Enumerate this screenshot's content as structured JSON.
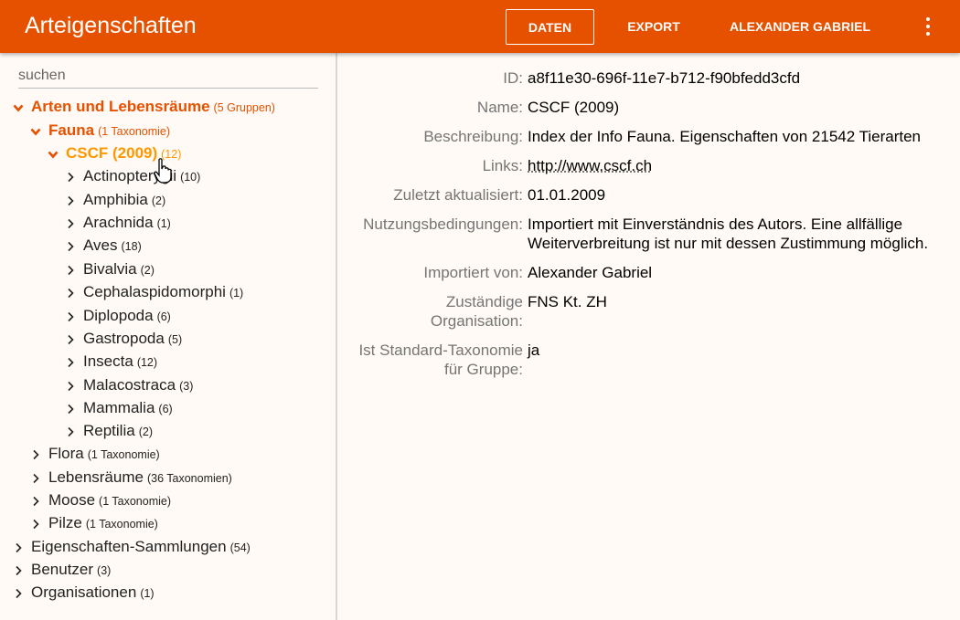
{
  "header": {
    "title": "Arteigenschaften",
    "nav": [
      "Daten",
      "Export",
      "Alexander Gabriel"
    ],
    "more_icon": "more-vert-icon"
  },
  "search": {
    "placeholder": "suchen",
    "value": ""
  },
  "tree": [
    {
      "label": "Arten und Lebensräume",
      "count": "(5 Gruppen)",
      "state": "open"
    },
    {
      "label": "Fauna",
      "count": "(1 Taxonomie)",
      "state": "open"
    },
    {
      "label": "CSCF (2009)",
      "count": "(12)",
      "state": "selected"
    },
    {
      "label": "Actinopterygii",
      "count": "(10)",
      "state": "closed"
    },
    {
      "label": "Amphibia",
      "count": "(2)",
      "state": "closed"
    },
    {
      "label": "Arachnida",
      "count": "(1)",
      "state": "closed"
    },
    {
      "label": "Aves",
      "count": "(18)",
      "state": "closed"
    },
    {
      "label": "Bivalvia",
      "count": "(2)",
      "state": "closed"
    },
    {
      "label": "Cephalaspidomorphi",
      "count": "(1)",
      "state": "closed"
    },
    {
      "label": "Diplopoda",
      "count": "(6)",
      "state": "closed"
    },
    {
      "label": "Gastropoda",
      "count": "(5)",
      "state": "closed"
    },
    {
      "label": "Insecta",
      "count": "(12)",
      "state": "closed"
    },
    {
      "label": "Malacostraca",
      "count": "(3)",
      "state": "closed"
    },
    {
      "label": "Mammalia",
      "count": "(6)",
      "state": "closed"
    },
    {
      "label": "Reptilia",
      "count": "(2)",
      "state": "closed"
    },
    {
      "label": "Flora",
      "count": "(1 Taxonomie)",
      "state": "closed"
    },
    {
      "label": "Lebensräume",
      "count": "(36 Taxonomien)",
      "state": "closed"
    },
    {
      "label": "Moose",
      "count": "(1 Taxonomie)",
      "state": "closed"
    },
    {
      "label": "Pilze",
      "count": "(1 Taxonomie)",
      "state": "closed"
    },
    {
      "label": "Eigenschaften-Sammlungen",
      "count": "(54)",
      "state": "closed"
    },
    {
      "label": "Benutzer",
      "count": "(3)",
      "state": "closed"
    },
    {
      "label": "Organisationen",
      "count": "(1)",
      "state": "closed"
    }
  ],
  "details": {
    "id": {
      "label": "ID:",
      "value": "a8f11e30-696f-11e7-b712-f90bfedd3cfd"
    },
    "name": {
      "label": "Name:",
      "value": "CSCF (2009)"
    },
    "beschreibung": {
      "label": "Beschreibung:",
      "value": "Index der Info Fauna. Eigenschaften von 21542 Tierarten"
    },
    "links": {
      "label": "Links:",
      "value": "http://www.cscf.ch"
    },
    "aktualisiert": {
      "label": "Zuletzt aktualisiert:",
      "value": "01.01.2009"
    },
    "nutzung": {
      "label": "Nutzungsbedingungen:",
      "value_line1": "Importiert mit Einverständnis des Autors. Eine allfällige",
      "value_line2": "Weiterverbreitung ist nur mit dessen Zustimmung möglich."
    },
    "importiert": {
      "label": "Importiert von:",
      "value": "Alexander Gabriel"
    },
    "organisation": {
      "label_line1": "Zuständige",
      "label_line2": "Organisation:",
      "value": "FNS Kt. ZH"
    },
    "standard": {
      "label_line1": "Ist Standard-Taxonomie",
      "label_line2": "für Gruppe:",
      "value": "ja"
    }
  }
}
